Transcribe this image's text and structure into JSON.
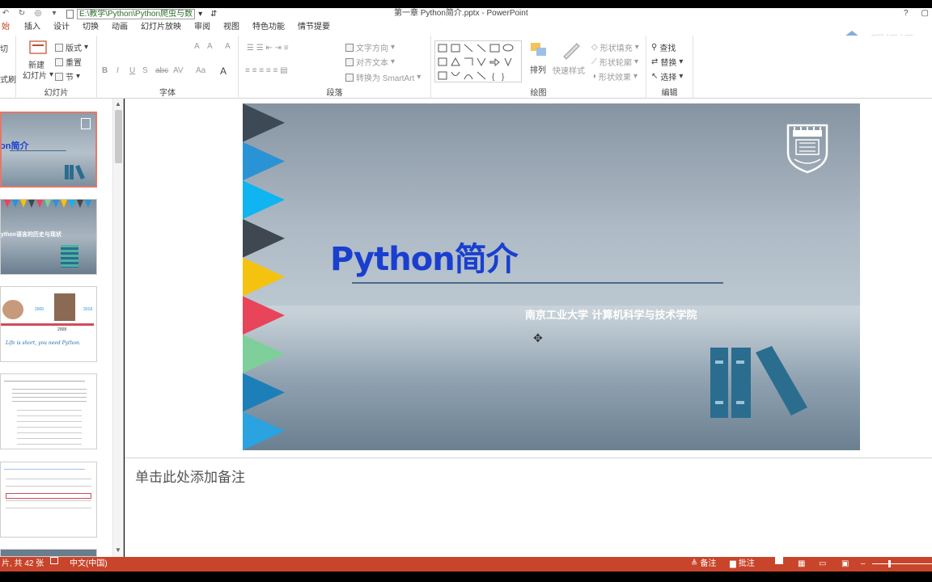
{
  "titlebar": {
    "path": "E:\\教学\\Python\\Python爬虫与数",
    "window_title": "第一章 Python简介.pptx - PowerPoint",
    "help": "?",
    "restore": "▢"
  },
  "tabs": [
    "始",
    "插入",
    "设计",
    "切换",
    "动画",
    "幻灯片放映",
    "审阅",
    "视图",
    "特色功能",
    "情节提要"
  ],
  "ribbon": {
    "clipboard": {
      "paste_partial": "切",
      "format_partial": "式刷"
    },
    "slides": {
      "label": "幻灯片",
      "new_slide": "新建",
      "new_slide2": "幻灯片",
      "layout": "版式",
      "reset": "重置",
      "section": "节"
    },
    "font": {
      "label": "字体",
      "bold": "B",
      "italic": "I",
      "underline": "U",
      "strike": "S",
      "abc": "abc",
      "av": "AV",
      "aa": "Aa",
      "fontcolor": "A",
      "grow": "A",
      "shrink": "A",
      "clear": "A"
    },
    "paragraph": {
      "label": "段落",
      "text_dir": "文字方向",
      "align_text": "对齐文本",
      "smartart": "转换为 SmartArt"
    },
    "drawing": {
      "label": "绘图",
      "arrange": "排列",
      "quick_styles": "快速样式",
      "fill": "形状填充",
      "outline": "形状轮廓",
      "effect": "形状效果"
    },
    "editing": {
      "label": "编辑",
      "find": "查找",
      "replace": "替换",
      "select": "选择"
    }
  },
  "watermark": "腾讯课",
  "thumbnails": [
    {
      "text": "on简介"
    },
    {
      "text": "ython语言的历史与现状"
    },
    {
      "text_years": [
        "2000",
        "2018",
        "2008"
      ],
      "quote": "Life is short, you need Python."
    },
    {
      "text": "…"
    },
    {
      "text": "…"
    }
  ],
  "slide": {
    "title": "Python简介",
    "subtitle": "南京工业大学    计算机科学与技术学院",
    "triangle_colors": [
      "#3d4a55",
      "#2a93d5",
      "#0fb4f0",
      "#3f4850",
      "#f5c30f",
      "#e8445a",
      "#7fcf9a",
      "#1d7fb8",
      "#2aa3e0"
    ],
    "books_color": "#2a6d8f"
  },
  "notes": {
    "placeholder": "单击此处添加备注"
  },
  "status": {
    "slide_count": "片, 共 42 张",
    "language": "中文(中国)",
    "notes": "备注",
    "comments": "批注"
  }
}
